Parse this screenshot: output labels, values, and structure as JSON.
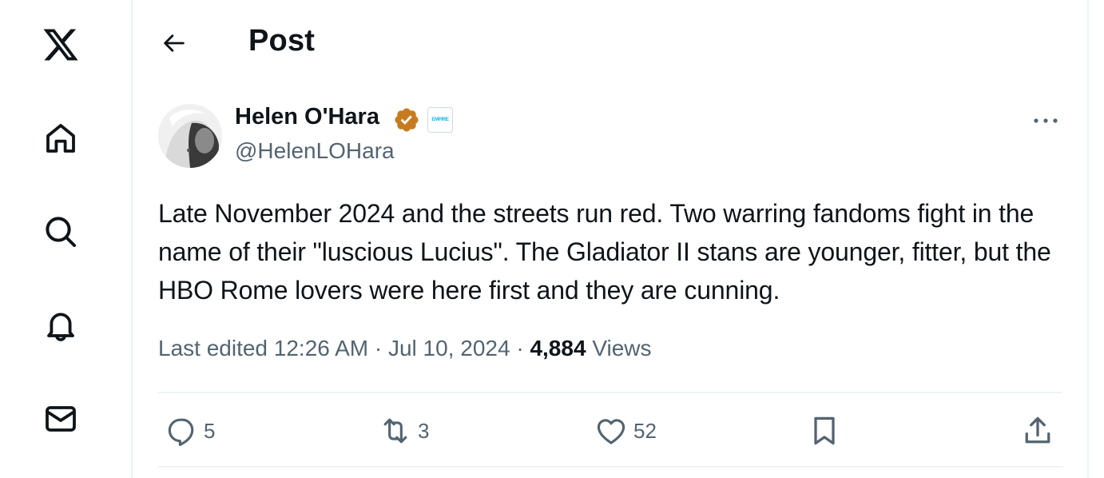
{
  "sidebar": {
    "items": [
      {
        "name": "x-logo-icon",
        "label": "X"
      },
      {
        "name": "home-icon",
        "label": "Home"
      },
      {
        "name": "search-icon",
        "label": "Explore"
      },
      {
        "name": "bell-icon",
        "label": "Notifications"
      },
      {
        "name": "mail-icon",
        "label": "Messages"
      }
    ]
  },
  "header": {
    "back_icon": "arrow-left-icon",
    "title": "Post"
  },
  "post": {
    "author": {
      "name": "Helen O'Hara",
      "handle": "@HelenLOHara",
      "verified_color": "#c77b1f",
      "affiliate_badge": "EMPIRE"
    },
    "text": "Late November 2024 and the streets run red. Two warring fandoms fight in the name of their \"luscious Lucius\". The Gladiator II stans are younger, fitter, but the HBO Rome lovers were here first and they are cunning.",
    "meta": {
      "edited_label": "Last edited",
      "time": "12:26 AM",
      "separator": "·",
      "date": "Jul 10, 2024",
      "views_count": "4,884",
      "views_label": "Views"
    },
    "actions": {
      "replies": "5",
      "reposts": "3",
      "likes": "52"
    }
  },
  "colors": {
    "text_primary": "#0f1419",
    "text_secondary": "#536471",
    "border": "#eff3f4"
  }
}
